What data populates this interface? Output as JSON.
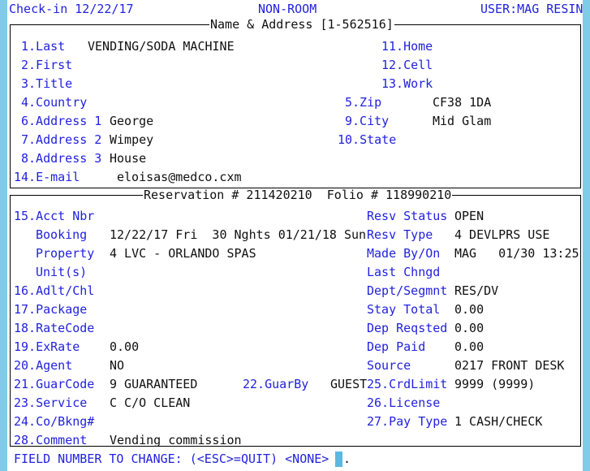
{
  "colors": {
    "label": "#2222dd",
    "value": "#101010",
    "gutter": "#7fcce9",
    "cursor": "#5bb8e0",
    "frame": "#000000",
    "background": "#ffffff"
  },
  "header": {
    "left": "Check-in 12/22/17",
    "center": "NON-ROOM",
    "right": "USER:MAG RESIN"
  },
  "name_address_panel": {
    "legend": "Name & Address [1-562516]",
    "left_fields": [
      {
        "label": "1.Last",
        "value": "VENDING/SODA MACHINE"
      },
      {
        "label": "2.First",
        "value": ""
      },
      {
        "label": "3.Title",
        "value": ""
      },
      {
        "label": "4.Country",
        "value": ""
      },
      {
        "label": "6.Address 1",
        "value": "George"
      },
      {
        "label": "7.Address 2",
        "value": "Wimpey"
      },
      {
        "label": "8.Address 3",
        "value": "House"
      },
      {
        "label": "14.E-mail",
        "value": "eloisas@medco.cxm"
      }
    ],
    "right_fields": [
      {
        "label": "11.Home",
        "value": ""
      },
      {
        "label": "12.Cell",
        "value": ""
      },
      {
        "label": "13.Work",
        "value": ""
      },
      {
        "label": "5.Zip",
        "value": "CF38 1DA"
      },
      {
        "label": "9.City",
        "value": "Mid Glam"
      },
      {
        "label": "10.State",
        "value": ""
      }
    ]
  },
  "reservation_panel": {
    "legend": "Reservation # 211420210  Folio # 118990210",
    "reservation_number": "211420210",
    "folio_number": "118990210",
    "left_fields": [
      {
        "label": "15.Acct Nbr",
        "value": ""
      },
      {
        "label": "Booking",
        "value": "12/22/17 Fri  30 Nghts 01/21/18 Sun"
      },
      {
        "label": "Property",
        "value": "4 LVC - ORLANDO SPAS"
      },
      {
        "label": "Unit(s)",
        "value": ""
      },
      {
        "label": "16.Adlt/Chl",
        "value": ""
      },
      {
        "label": "17.Package",
        "value": ""
      },
      {
        "label": "18.RateCode",
        "value": ""
      },
      {
        "label": "19.ExRate",
        "value": "0.00"
      },
      {
        "label": "20.Agent",
        "value": "NO"
      },
      {
        "label": "21.GuarCode",
        "value": "9 GUARANTEED"
      },
      {
        "label": "23.Service",
        "value": "C C/O CLEAN"
      },
      {
        "label": "24.Co/Bkng#",
        "value": ""
      },
      {
        "label": "28.Comment",
        "value": "Vending commission"
      }
    ],
    "mid_fields": [
      {
        "label": "22.GuarBy",
        "value": "GUEST"
      }
    ],
    "right_fields": [
      {
        "label": "Resv Status",
        "value": "OPEN"
      },
      {
        "label": "Resv Type",
        "value": "4 DEVLPRS USE"
      },
      {
        "label": "Made By/On",
        "value": "MAG   01/30 13:25"
      },
      {
        "label": "Last Chngd",
        "value": ""
      },
      {
        "label": "Dept/Segmnt",
        "value": "RES/DV"
      },
      {
        "label": "Stay Total",
        "value": "0.00"
      },
      {
        "label": "Dep Reqsted",
        "value": "0.00"
      },
      {
        "label": "Dep Paid",
        "value": "0.00"
      },
      {
        "label": "Source",
        "value": "0217 FRONT DESK"
      },
      {
        "label": "25.CrdLimit",
        "value": "9999 (9999)"
      },
      {
        "label": "26.License",
        "value": ""
      },
      {
        "label": "27.Pay Type",
        "value": "1 CASH/CHECK"
      }
    ]
  },
  "prompt": {
    "text": "FIELD NUMBER TO CHANGE: (<ESC>=QUIT) <NONE>",
    "trailing": "."
  }
}
